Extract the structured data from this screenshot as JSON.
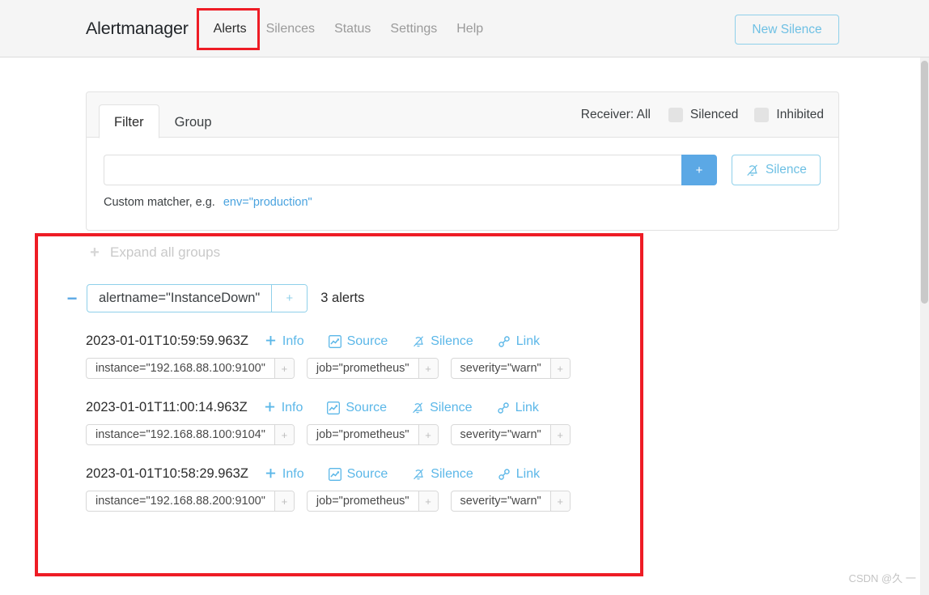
{
  "header": {
    "brand": "Alertmanager",
    "nav": [
      {
        "label": "Alerts",
        "active": true
      },
      {
        "label": "Silences",
        "active": false
      },
      {
        "label": "Status",
        "active": false
      },
      {
        "label": "Settings",
        "active": false
      },
      {
        "label": "Help",
        "active": false
      }
    ],
    "new_silence_label": "New Silence"
  },
  "filter_panel": {
    "tabs": [
      {
        "label": "Filter",
        "active": true
      },
      {
        "label": "Group",
        "active": false
      }
    ],
    "receiver_label": "Receiver: All",
    "silenced_label": "Silenced",
    "inhibited_label": "Inhibited",
    "matcher_value": "",
    "matcher_placeholder": "",
    "add_button_label": "+",
    "silence_button_label": "Silence",
    "hint_text": "Custom matcher, e.g.",
    "hint_code": "env=\"production\""
  },
  "alerts": {
    "expand_all_label": "Expand all groups",
    "collapse_toggle_label": "−",
    "group": {
      "matcher": "alertname=\"InstanceDown\"",
      "add_label": "+",
      "count_label": "3 alerts"
    },
    "actions": {
      "info": "Info",
      "source": "Source",
      "silence": "Silence",
      "link": "Link"
    },
    "label_add": "+",
    "items": [
      {
        "time": "2023-01-01T10:59:59.963Z",
        "labels": [
          "instance=\"192.168.88.100:9100\"",
          "job=\"prometheus\"",
          "severity=\"warn\""
        ]
      },
      {
        "time": "2023-01-01T11:00:14.963Z",
        "labels": [
          "instance=\"192.168.88.100:9104\"",
          "job=\"prometheus\"",
          "severity=\"warn\""
        ]
      },
      {
        "time": "2023-01-01T10:58:29.963Z",
        "labels": [
          "instance=\"192.168.88.200:9100\"",
          "job=\"prometheus\"",
          "severity=\"warn\""
        ]
      }
    ]
  },
  "watermark": "CSDN @久 一",
  "colors": {
    "accent": "#5ba8e5",
    "link": "#5bb7e8",
    "annotation": "#ee1c25",
    "header_bg": "#f5f5f5"
  }
}
